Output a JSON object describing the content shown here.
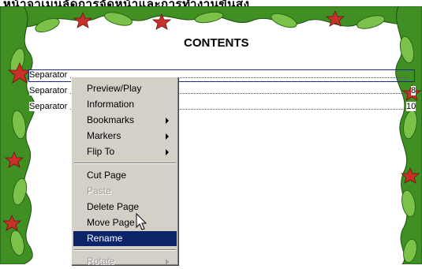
{
  "banner": {
    "text": "หน้าจาเมนูลัดการจัดหน้าและการทำงานขั้นสูง"
  },
  "page": {
    "title": "CONTENTS",
    "toc": [
      {
        "label": "Separator",
        "page": ""
      },
      {
        "label": "Separator",
        "page": "8"
      },
      {
        "label": "Separator",
        "page": "10"
      }
    ]
  },
  "menu": {
    "items": [
      {
        "label": "Preview/Play",
        "enabled": true,
        "submenu": false
      },
      {
        "label": "Information",
        "enabled": true,
        "submenu": false
      },
      {
        "label": "Bookmarks",
        "enabled": true,
        "submenu": true
      },
      {
        "label": "Markers",
        "enabled": true,
        "submenu": true
      },
      {
        "label": "Flip To",
        "enabled": true,
        "submenu": true
      },
      {
        "label": "Cut Page",
        "enabled": true,
        "submenu": false
      },
      {
        "label": "Paste",
        "enabled": false,
        "submenu": false
      },
      {
        "label": "Delete Page",
        "enabled": true,
        "submenu": false
      },
      {
        "label": "Move Page",
        "enabled": true,
        "submenu": false
      },
      {
        "label": "Rename",
        "enabled": true,
        "submenu": false,
        "highlighted": true
      },
      {
        "label": "Rotate",
        "enabled": false,
        "submenu": true
      }
    ]
  },
  "colors": {
    "highlight": "#0a246a",
    "menu_bg": "#d4d0c8",
    "leaf": "#2e7d1a",
    "star": "#c8312a",
    "selection_border": "#1d2b8c"
  }
}
